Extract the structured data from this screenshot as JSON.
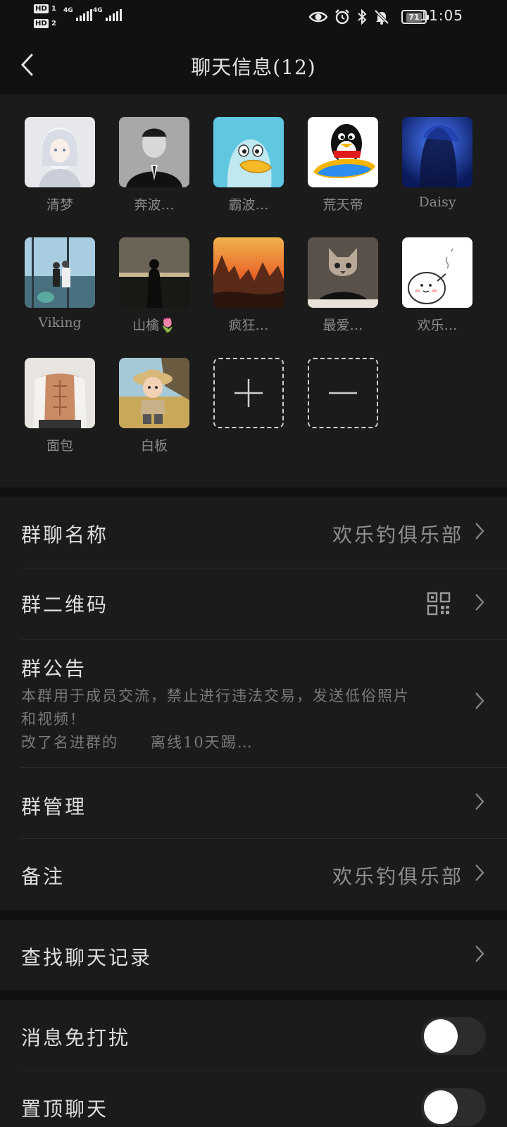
{
  "status_bar": {
    "hd1": "HD",
    "sim1": "1",
    "hd2": "HD",
    "sim2": "2",
    "net1": "4G",
    "net2": "4G",
    "battery": "71",
    "time": "11:05",
    "icons": [
      "eye-icon",
      "alarm-icon",
      "bluetooth-icon",
      "mute-bell-icon"
    ]
  },
  "header": {
    "back_icon": "chevron-left-icon",
    "title": "聊天信息(12)"
  },
  "members": [
    {
      "name": "清梦",
      "avatar": "anime-girl-white-hair"
    },
    {
      "name": "奔波…",
      "avatar": "bw-portrait-man"
    },
    {
      "name": "霸波…",
      "avatar": "cartoon-duck-blue"
    },
    {
      "name": "荒天帝",
      "avatar": "qq-penguin"
    },
    {
      "name": "Daisy",
      "avatar": "blue-silhouette"
    },
    {
      "name": "Viking",
      "avatar": "window-family"
    },
    {
      "name": "山檎🌷",
      "avatar": "girl-sunset-silhouette"
    },
    {
      "name": "疯狂…",
      "avatar": "sunset-rocks"
    },
    {
      "name": "最爱…",
      "avatar": "cat-head-person"
    },
    {
      "name": "欢乐…",
      "avatar": "white-blob-meme"
    },
    {
      "name": "面包",
      "avatar": "muscle-man"
    },
    {
      "name": "白板",
      "avatar": "baby-straw-hat"
    }
  ],
  "member_actions": {
    "add_icon": "plus-icon",
    "remove_icon": "minus-icon"
  },
  "settings": {
    "group_name_label": "群聊名称",
    "group_name_value": "欢乐钓俱乐部",
    "qrcode_label": "群二维码",
    "qrcode_icon": "qr-code-icon",
    "notice_label": "群公告",
    "notice_line1": "本群用于成员交流，禁止进行违法交易，发送低俗照片",
    "notice_line2": "和视频！",
    "notice_line3": "改了名进群的　　离线10天踢…",
    "manage_label": "群管理",
    "remark_label": "备注",
    "remark_value": "欢乐钓俱乐部",
    "search_history_label": "查找聊天记录",
    "mute_label": "消息免打扰",
    "mute_on": false,
    "pin_label": "置顶聊天",
    "pin_on": false
  },
  "colors": {
    "background": "#111111",
    "panel": "#1b1b1b",
    "primary_text": "#dedede",
    "secondary_text": "#8f8f8f",
    "toggle_track": "#2c2c2c",
    "toggle_knob": "#ffffff"
  }
}
